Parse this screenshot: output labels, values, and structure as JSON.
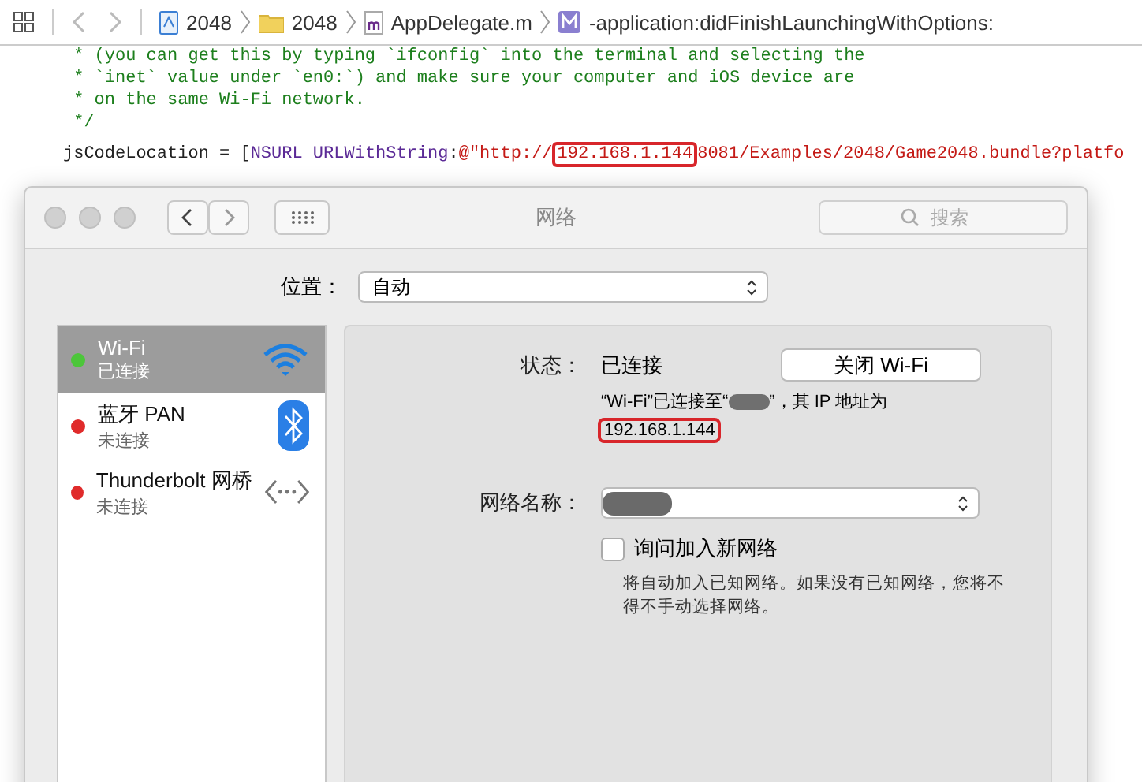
{
  "breadcrumb": [
    {
      "label": "2048",
      "kind": "project"
    },
    {
      "label": "2048",
      "kind": "folder"
    },
    {
      "label": "AppDelegate.m",
      "kind": "file"
    },
    {
      "label": "-application:didFinishLaunchingWithOptions:",
      "kind": "method"
    }
  ],
  "code_lines": [
    [
      {
        "kind": "comment",
        "text": " * (you can get this by typing `ifconfig` into the terminal and selecting the"
      }
    ],
    [
      {
        "kind": "comment",
        "text": " * `inet` value under `en0:`) and make sure your computer and iOS device are"
      }
    ],
    [
      {
        "kind": "comment",
        "text": " * on the same Wi-Fi network."
      }
    ],
    [
      {
        "kind": "comment",
        "text": " */"
      }
    ],
    [
      {
        "kind": "plain",
        "text": "jsCodeLocation = ["
      },
      {
        "kind": "type",
        "text": "NSURL URLWithString"
      },
      {
        "kind": "plain",
        "text": ":"
      },
      {
        "kind": "string",
        "text": "@\"http://"
      },
      {
        "kind": "highlight",
        "text": "192.168.1.144"
      },
      {
        "kind": "string",
        "text": "8081/Examples/2048/Game2048.bundle?platfo"
      }
    ]
  ],
  "window": {
    "title": "网络",
    "search": {
      "placeholder": "搜索"
    }
  },
  "location": {
    "label": "位置：",
    "value": "自动"
  },
  "services": [
    {
      "name": "Wi-Fi",
      "status": "已连接",
      "color": "#4cc63a",
      "selected": true,
      "kind": "wifi"
    },
    {
      "name": "蓝牙 PAN",
      "status": "未连接",
      "color": "#e02b2b",
      "selected": false,
      "kind": "bluetooth"
    },
    {
      "name": "Thunderbolt 网桥",
      "status": "未连接",
      "color": "#e02b2b",
      "selected": false,
      "kind": "bridge"
    }
  ],
  "detail": {
    "status_label": "状态：",
    "status_value": "已连接",
    "toggle_button": "关闭 Wi-Fi",
    "info_prefix": "“Wi-Fi”已连接至“",
    "info_suffix": "”，其 IP 地址为",
    "ip": "192.168.1.144",
    "network_label": "网络名称：",
    "ask_join": {
      "label": "询问加入新网络",
      "checked": false
    },
    "hint": "将自动加入已知网络。如果没有已知网络，您将不得不手动选择网络。"
  }
}
